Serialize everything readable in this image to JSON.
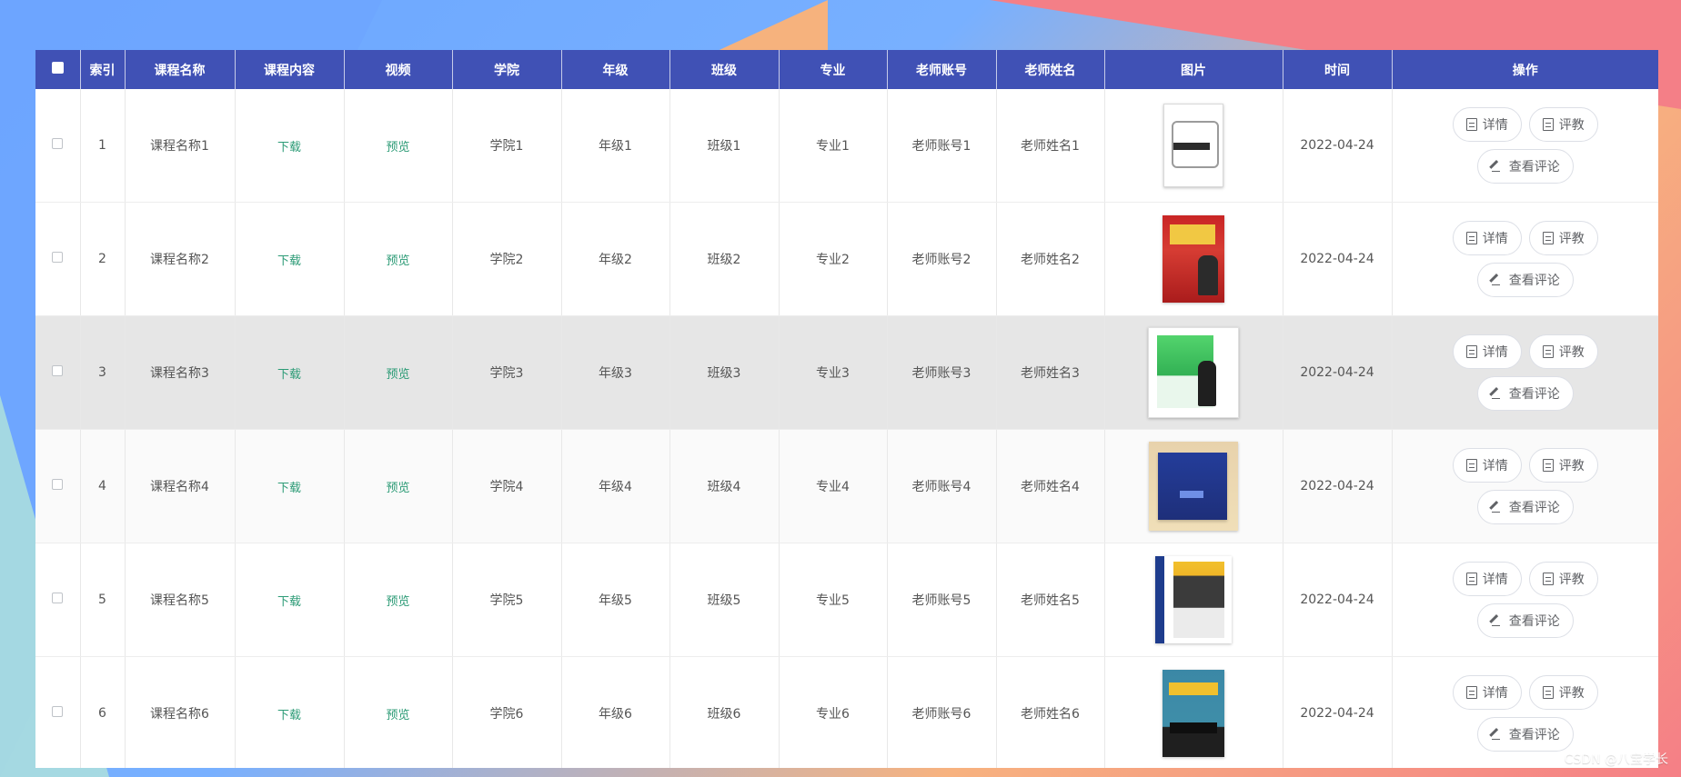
{
  "columns": {
    "select": "",
    "index": "索引",
    "course_name": "课程名称",
    "course_content": "课程内容",
    "video": "视频",
    "college": "学院",
    "grade": "年级",
    "class": "班级",
    "major": "专业",
    "teacher_account": "老师账号",
    "teacher_name": "老师姓名",
    "image": "图片",
    "time": "时间",
    "actions": "操作"
  },
  "rows": [
    {
      "index": "1",
      "course_name": "课程名称1",
      "course_content": "下载",
      "video": "预览",
      "college": "学院1",
      "grade": "年级1",
      "class": "班级1",
      "major": "专业1",
      "teacher_account": "老师账号1",
      "teacher_name": "老师姓名1",
      "time": "2022-04-24",
      "actions": {
        "detail": "详情",
        "evaluate": "评教",
        "view_comments": "查看评论"
      }
    },
    {
      "index": "2",
      "course_name": "课程名称2",
      "course_content": "下载",
      "video": "预览",
      "college": "学院2",
      "grade": "年级2",
      "class": "班级2",
      "major": "专业2",
      "teacher_account": "老师账号2",
      "teacher_name": "老师姓名2",
      "time": "2022-04-24",
      "actions": {
        "detail": "详情",
        "evaluate": "评教",
        "view_comments": "查看评论"
      }
    },
    {
      "index": "3",
      "course_name": "课程名称3",
      "course_content": "下载",
      "video": "预览",
      "college": "学院3",
      "grade": "年级3",
      "class": "班级3",
      "major": "专业3",
      "teacher_account": "老师账号3",
      "teacher_name": "老师姓名3",
      "time": "2022-04-24",
      "actions": {
        "detail": "详情",
        "evaluate": "评教",
        "view_comments": "查看评论"
      }
    },
    {
      "index": "4",
      "course_name": "课程名称4",
      "course_content": "下载",
      "video": "预览",
      "college": "学院4",
      "grade": "年级4",
      "class": "班级4",
      "major": "专业4",
      "teacher_account": "老师账号4",
      "teacher_name": "老师姓名4",
      "time": "2022-04-24",
      "actions": {
        "detail": "详情",
        "evaluate": "评教",
        "view_comments": "查看评论"
      }
    },
    {
      "index": "5",
      "course_name": "课程名称5",
      "course_content": "下载",
      "video": "预览",
      "college": "学院5",
      "grade": "年级5",
      "class": "班级5",
      "major": "专业5",
      "teacher_account": "老师账号5",
      "teacher_name": "老师姓名5",
      "time": "2022-04-24",
      "actions": {
        "detail": "详情",
        "evaluate": "评教",
        "view_comments": "查看评论"
      }
    },
    {
      "index": "6",
      "course_name": "课程名称6",
      "course_content": "下载",
      "video": "预览",
      "college": "学院6",
      "grade": "年级6",
      "class": "班级6",
      "major": "专业6",
      "teacher_account": "老师账号6",
      "teacher_name": "老师姓名6",
      "time": "2022-04-24",
      "actions": {
        "detail": "详情",
        "evaluate": "评教",
        "view_comments": "查看评论"
      }
    }
  ],
  "watermark": "CSDN @八宝学长",
  "colors": {
    "header_bg": "#4051b5",
    "link": "#2c9b76",
    "hover_row": "#e6e6e6"
  }
}
